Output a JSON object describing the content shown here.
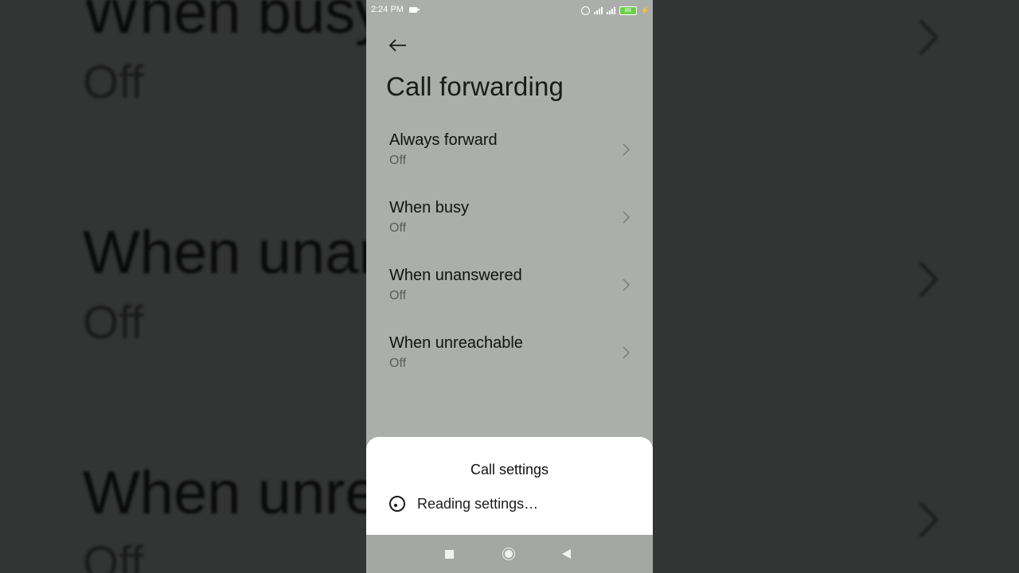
{
  "status_bar": {
    "time": "2:24 PM",
    "battery": "89",
    "icons": [
      "video-camera-icon",
      "alarm-icon",
      "signal-icon",
      "signal-icon",
      "battery-icon",
      "charging-bolt-icon"
    ]
  },
  "header": {
    "back_icon": "back-arrow-icon",
    "title": "Call forwarding"
  },
  "forwarding_options": [
    {
      "title": "Always forward",
      "status": "Off"
    },
    {
      "title": "When busy",
      "status": "Off"
    },
    {
      "title": "When unanswered",
      "status": "Off"
    },
    {
      "title": "When unreachable",
      "status": "Off"
    }
  ],
  "background_copy": {
    "items": [
      {
        "title": "When busy",
        "status": "Off"
      },
      {
        "title": "When unanswered",
        "status": "Off"
      },
      {
        "title": "When unreachable",
        "status": "Off"
      }
    ]
  },
  "dialog": {
    "title": "Call settings",
    "message": "Reading settings…"
  },
  "nav_bar": {
    "icons": [
      "recent-apps-icon",
      "home-icon",
      "back-icon"
    ]
  },
  "colors": {
    "screen_bg": "#abaeaa",
    "outer_bg": "#333434",
    "sheet_bg": "#ffffff",
    "battery": "#6bd04a"
  }
}
